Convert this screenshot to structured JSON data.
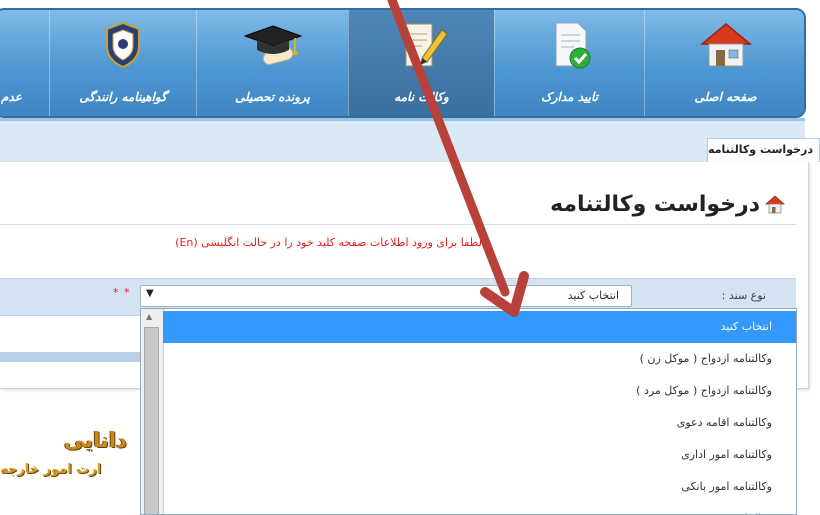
{
  "nav": {
    "items": [
      {
        "label": "صفحه اصلی",
        "icon": "home-icon"
      },
      {
        "label": "تایید مدارک",
        "icon": "document-check-icon"
      },
      {
        "label": "وکالت نامه",
        "icon": "document-pen-icon"
      },
      {
        "label": "پرونده تحصیلی",
        "icon": "graduation-cap-icon"
      },
      {
        "label": "گواهینامه رانندگی",
        "icon": "police-badge-icon"
      },
      {
        "label": "عدم"
      }
    ]
  },
  "tab": {
    "label": "درخواست وکالتنامه"
  },
  "page": {
    "title": "درخواست وکالتنامه",
    "title_icon": "home-icon",
    "instruction": "لطفا برای ورود اطلاعات صفحه کلید خود را در حالت انگلیسی (En)"
  },
  "form": {
    "doc_type_label": "نوع سند :",
    "required_mark": "* *",
    "select_value": "انتخاب کنید"
  },
  "dropdown": {
    "options": [
      "انتخاب کنید",
      "وکالتنامه ازدواج ( موکل زن )",
      "وکالتنامه ازدواج ( موکل مرد )",
      "وکالتنامه اقامه دعوی",
      "وکالتنامه امور اداری",
      "وکالتنامه امور بانکی",
      "وکالتنامه"
    ],
    "selected_index": 0
  },
  "logo": {
    "line1": "دانایی",
    "line2": "ارت امور خارجه"
  },
  "colors": {
    "nav_blue": "#4d97d2",
    "selected_option": "#3399ff",
    "required_red": "#e0211e",
    "arrow": "#b8423a"
  }
}
